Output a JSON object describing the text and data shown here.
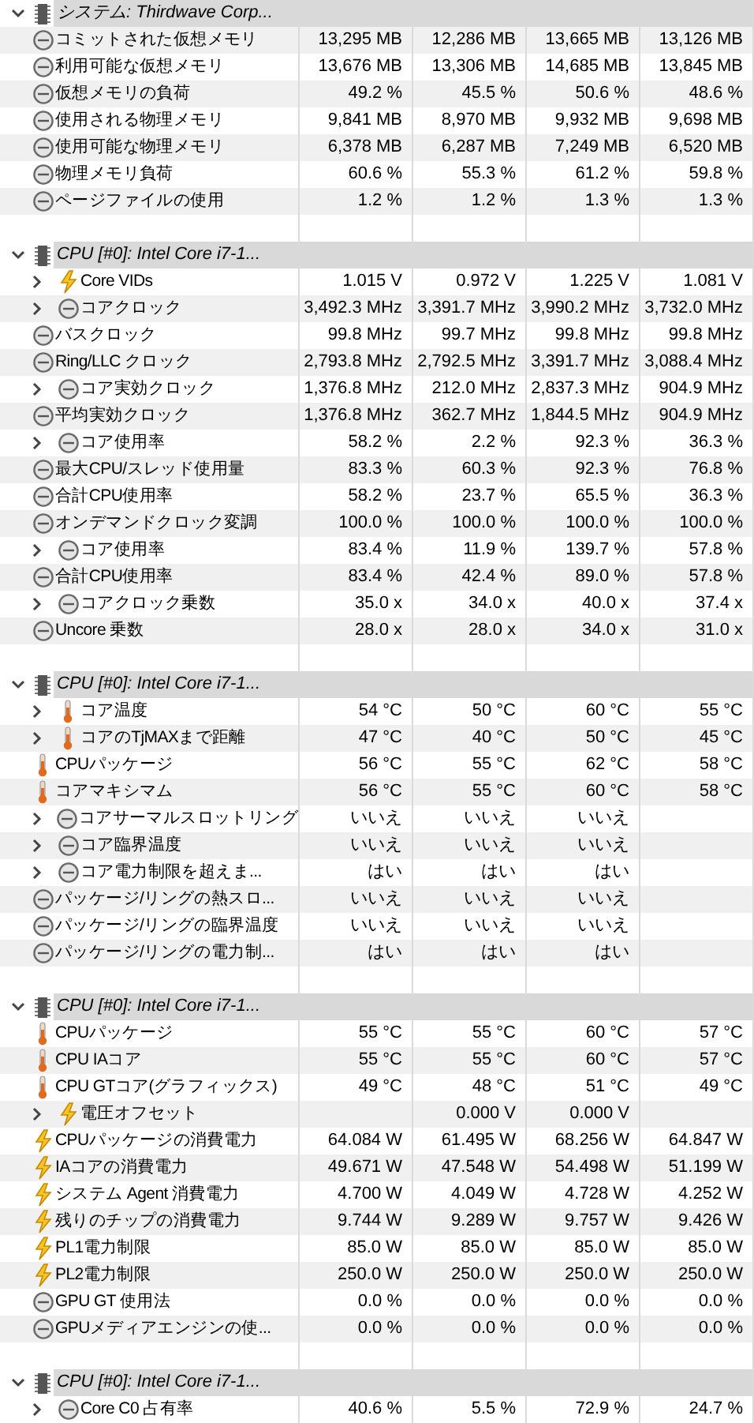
{
  "groups": [
    {
      "title": "システム: Thirdwave Corp...",
      "expanded": true,
      "rows": [
        {
          "label": "コミットされた仮想メモリ",
          "kind": "clock",
          "expandable": false,
          "values": [
            "13,295 MB",
            "12,286 MB",
            "13,665 MB",
            "13,126 MB"
          ]
        },
        {
          "label": "利用可能な仮想メモリ",
          "kind": "clock",
          "expandable": false,
          "values": [
            "13,676 MB",
            "13,306 MB",
            "14,685 MB",
            "13,845 MB"
          ]
        },
        {
          "label": "仮想メモリの負荷",
          "kind": "clock",
          "expandable": false,
          "values": [
            "49.2 %",
            "45.5 %",
            "50.6 %",
            "48.6 %"
          ]
        },
        {
          "label": "使用される物理メモリ",
          "kind": "clock",
          "expandable": false,
          "values": [
            "9,841 MB",
            "8,970 MB",
            "9,932 MB",
            "9,698 MB"
          ]
        },
        {
          "label": "使用可能な物理メモリ",
          "kind": "clock",
          "expandable": false,
          "values": [
            "6,378 MB",
            "6,287 MB",
            "7,249 MB",
            "6,520 MB"
          ]
        },
        {
          "label": "物理メモリ負荷",
          "kind": "clock",
          "expandable": false,
          "values": [
            "60.6 %",
            "55.3 %",
            "61.2 %",
            "59.8 %"
          ]
        },
        {
          "label": "ページファイルの使用",
          "kind": "clock",
          "expandable": false,
          "values": [
            "1.2 %",
            "1.2 %",
            "1.3 %",
            "1.3 %"
          ]
        }
      ]
    },
    {
      "title": "CPU [#0]: Intel Core i7-1...",
      "expanded": true,
      "rows": [
        {
          "label": "Core VIDs",
          "kind": "bolt",
          "expandable": true,
          "values": [
            "1.015 V",
            "0.972 V",
            "1.225 V",
            "1.081 V"
          ]
        },
        {
          "label": "コアクロック",
          "kind": "clock",
          "expandable": true,
          "values": [
            "3,492.3 MHz",
            "3,391.7 MHz",
            "3,990.2 MHz",
            "3,732.0 MHz"
          ]
        },
        {
          "label": "バスクロック",
          "kind": "clock",
          "expandable": false,
          "values": [
            "99.8 MHz",
            "99.7 MHz",
            "99.8 MHz",
            "99.8 MHz"
          ]
        },
        {
          "label": "Ring/LLC クロック",
          "kind": "clock",
          "expandable": false,
          "values": [
            "2,793.8 MHz",
            "2,792.5 MHz",
            "3,391.7 MHz",
            "3,088.4 MHz"
          ]
        },
        {
          "label": "コア実効クロック",
          "kind": "clock",
          "expandable": true,
          "values": [
            "1,376.8 MHz",
            "212.0 MHz",
            "2,837.3 MHz",
            "904.9 MHz"
          ]
        },
        {
          "label": "平均実効クロック",
          "kind": "clock",
          "expandable": false,
          "values": [
            "1,376.8 MHz",
            "362.7 MHz",
            "1,844.5 MHz",
            "904.9 MHz"
          ]
        },
        {
          "label": "コア使用率",
          "kind": "clock",
          "expandable": true,
          "values": [
            "58.2 %",
            "2.2 %",
            "92.3 %",
            "36.3 %"
          ]
        },
        {
          "label": "最大CPU/スレッド使用量",
          "kind": "clock",
          "expandable": false,
          "values": [
            "83.3 %",
            "60.3 %",
            "92.3 %",
            "76.8 %"
          ]
        },
        {
          "label": "合計CPU使用率",
          "kind": "clock",
          "expandable": false,
          "values": [
            "58.2 %",
            "23.7 %",
            "65.5 %",
            "36.3 %"
          ]
        },
        {
          "label": "オンデマンドクロック変調",
          "kind": "clock",
          "expandable": false,
          "values": [
            "100.0 %",
            "100.0 %",
            "100.0 %",
            "100.0 %"
          ]
        },
        {
          "label": "コア使用率",
          "kind": "clock",
          "expandable": true,
          "values": [
            "83.4 %",
            "11.9 %",
            "139.7 %",
            "57.8 %"
          ]
        },
        {
          "label": "合計CPU使用率",
          "kind": "clock",
          "expandable": false,
          "values": [
            "83.4 %",
            "42.4 %",
            "89.0 %",
            "57.8 %"
          ]
        },
        {
          "label": "コアクロック乗数",
          "kind": "clock",
          "expandable": true,
          "values": [
            "35.0 x",
            "34.0 x",
            "40.0 x",
            "37.4 x"
          ]
        },
        {
          "label": "Uncore 乗数",
          "kind": "clock",
          "expandable": false,
          "values": [
            "28.0 x",
            "28.0 x",
            "34.0 x",
            "31.0 x"
          ]
        }
      ]
    },
    {
      "title": "CPU [#0]: Intel Core i7-1...",
      "expanded": true,
      "rows": [
        {
          "label": "コア温度",
          "kind": "thermo",
          "expandable": true,
          "values": [
            "54 °C",
            "50 °C",
            "60 °C",
            "55 °C"
          ]
        },
        {
          "label": "コアのTjMAXまで距離",
          "kind": "thermo",
          "expandable": true,
          "values": [
            "47 °C",
            "40 °C",
            "50 °C",
            "45 °C"
          ]
        },
        {
          "label": "CPUパッケージ",
          "kind": "thermo",
          "expandable": false,
          "values": [
            "56 °C",
            "55 °C",
            "62 °C",
            "58 °C"
          ]
        },
        {
          "label": "コアマキシマム",
          "kind": "thermo",
          "expandable": false,
          "values": [
            "56 °C",
            "55 °C",
            "60 °C",
            "58 °C"
          ]
        },
        {
          "label": "コアサーマルスロットリング",
          "kind": "clock",
          "expandable": true,
          "values": {
            "column_2": "いいえ",
            "column_3": "いいえ",
            "column_4": "いいえ"
          }
        },
        {
          "label": "コア臨界温度",
          "kind": "clock",
          "expandable": true,
          "values": {
            "column_2": "いいえ",
            "column_3": "いいえ",
            "column_4": "いいえ"
          }
        },
        {
          "label": "コア電力制限を超えま...",
          "kind": "clock",
          "expandable": true,
          "values": {
            "column_2": "はい",
            "column_3": "はい",
            "column_4": "はい"
          }
        },
        {
          "label": "パッケージ/リングの熱スロ...",
          "kind": "clock",
          "expandable": false,
          "values": {
            "column_2": "いいえ",
            "column_3": "いいえ",
            "column_4": "いいえ"
          }
        },
        {
          "label": "パッケージ/リングの臨界温度",
          "kind": "clock",
          "expandable": false,
          "values": {
            "column_2": "いいえ",
            "column_3": "いいえ",
            "column_4": "いいえ"
          }
        },
        {
          "label": "パッケージ/リングの電力制...",
          "kind": "clock",
          "expandable": false,
          "values": {
            "column_2": "はい",
            "column_3": "はい",
            "column_4": "はい"
          }
        }
      ]
    },
    {
      "title": "CPU [#0]: Intel Core i7-1...",
      "expanded": true,
      "rows": [
        {
          "label": "CPUパッケージ",
          "kind": "thermo",
          "expandable": false,
          "values": [
            "55 °C",
            "55 °C",
            "60 °C",
            "57 °C"
          ]
        },
        {
          "label": "CPU IAコア",
          "kind": "thermo",
          "expandable": false,
          "values": [
            "55 °C",
            "55 °C",
            "60 °C",
            "57 °C"
          ]
        },
        {
          "label": "CPU GTコア(グラフィックス)",
          "kind": "thermo",
          "expandable": false,
          "values": [
            "49 °C",
            "48 °C",
            "51 °C",
            "49 °C"
          ]
        },
        {
          "label": "電圧オフセット",
          "kind": "bolt",
          "expandable": true,
          "values": {
            "column_3": "0.000 V",
            "column_4": "0.000 V"
          }
        },
        {
          "label": "CPUパッケージの消費電力",
          "kind": "bolt",
          "expandable": false,
          "values": [
            "64.084 W",
            "61.495 W",
            "68.256 W",
            "64.847 W"
          ]
        },
        {
          "label": "IAコアの消費電力",
          "kind": "bolt",
          "expandable": false,
          "values": [
            "49.671 W",
            "47.548 W",
            "54.498 W",
            "51.199 W"
          ]
        },
        {
          "label": "システム Agent 消費電力",
          "kind": "bolt",
          "expandable": false,
          "values": [
            "4.700 W",
            "4.049 W",
            "4.728 W",
            "4.252 W"
          ]
        },
        {
          "label": "残りのチップの消費電力",
          "kind": "bolt",
          "expandable": false,
          "values": [
            "9.744 W",
            "9.289 W",
            "9.757 W",
            "9.426 W"
          ]
        },
        {
          "label": "PL1電力制限",
          "kind": "bolt",
          "expandable": false,
          "values": [
            "85.0 W",
            "85.0 W",
            "85.0 W",
            "85.0 W"
          ]
        },
        {
          "label": "PL2電力制限",
          "kind": "bolt",
          "expandable": false,
          "values": [
            "250.0 W",
            "250.0 W",
            "250.0 W",
            "250.0 W"
          ]
        },
        {
          "label": "GPU GT 使用法",
          "kind": "clock",
          "expandable": false,
          "values": [
            "0.0 %",
            "0.0 %",
            "0.0 %",
            "0.0 %"
          ]
        },
        {
          "label": "GPUメディアエンジンの使...",
          "kind": "clock",
          "expandable": false,
          "values": [
            "0.0 %",
            "0.0 %",
            "0.0 %",
            "0.0 %"
          ]
        }
      ]
    },
    {
      "title": "CPU [#0]: Intel Core i7-1...",
      "expanded": true,
      "rows": [
        {
          "label": "Core C0 占有率",
          "kind": "clock",
          "expandable": true,
          "values": [
            "40.6 %",
            "5.5 %",
            "72.9 %",
            "24.7 %"
          ]
        }
      ]
    }
  ]
}
